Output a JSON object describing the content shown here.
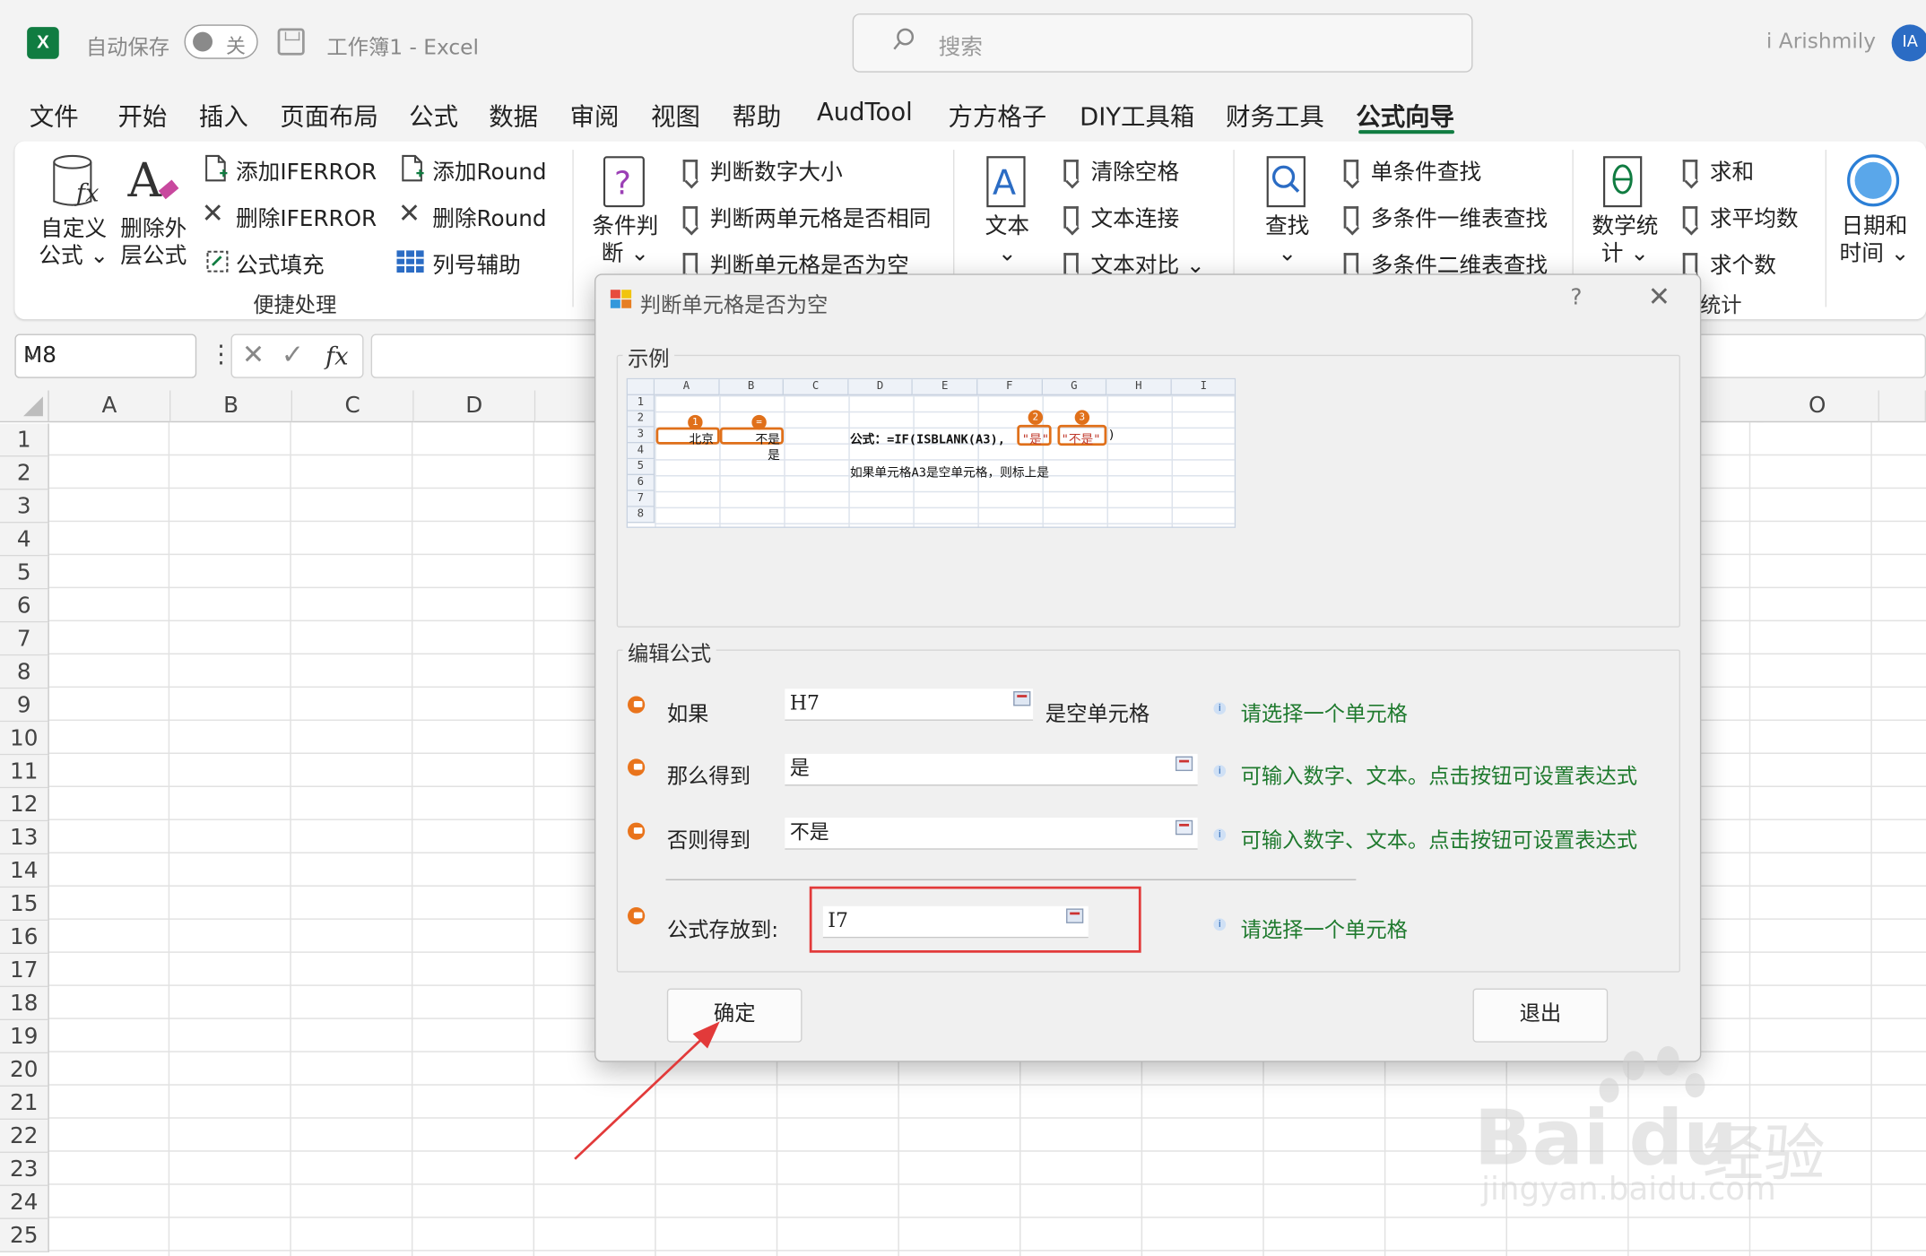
{
  "app": {
    "logo": "X",
    "autosave_label": "自动保存",
    "autosave_state": "关",
    "doc_title": "工作簿1  -  Excel",
    "search_placeholder": "搜索",
    "user_name": "i Arishmily",
    "user_initials": "IA"
  },
  "menu_tabs": [
    "文件",
    "开始",
    "插入",
    "页面布局",
    "公式",
    "数据",
    "审阅",
    "视图",
    "帮助",
    "AudTool",
    "方方格子",
    "DIY工具箱",
    "财务工具",
    "公式向导"
  ],
  "ribbon": {
    "custom_formula": "自定义\n公式 ⌄",
    "delete_outer": "删除外\n层公式",
    "add_iferror": "添加IFERROR",
    "del_iferror": "删除IFERROR",
    "formula_fill": "公式填充",
    "add_round": "添加Round",
    "del_round": "删除Round",
    "col_helper": "列号辅助",
    "group_quick": "便捷处理",
    "cond": "条件判\n断 ⌄",
    "is_number_size": "判断数字大小",
    "two_cells_same": "判断两单元格是否相同",
    "cell_is_empty": "判断单元格是否为空",
    "text": "文本\n⌄",
    "clear_spaces": "清除空格",
    "text_concat": "文本连接",
    "text_compare": "文本对比  ⌄",
    "lookup": "查找\n⌄",
    "single_lookup": "单条件查找",
    "multi_1d": "多条件一维表查找",
    "multi_2d": "多条件二维表查找",
    "math_stats": "数学统\n计 ⌄",
    "sum": "求和",
    "average": "求平均数",
    "count": "求个数",
    "stats_group": "统计",
    "datetime": "日期和\n时间 ⌄"
  },
  "formula_bar": {
    "name_box": "M8",
    "fx": "fx"
  },
  "sheet": {
    "columns": [
      "A",
      "B",
      "C",
      "D",
      "O"
    ],
    "rows": [
      "1",
      "2",
      "3",
      "4",
      "5",
      "6",
      "7",
      "8",
      "9",
      "10",
      "11",
      "12",
      "13",
      "14",
      "15",
      "16",
      "17",
      "18",
      "19",
      "20",
      "21",
      "22",
      "23",
      "24",
      "25"
    ]
  },
  "dialog": {
    "title": "判断单元格是否为空",
    "help": "?",
    "close": "✕",
    "example_legend": "示例",
    "example": {
      "cols": [
        "A",
        "B",
        "C",
        "D",
        "E",
        "F",
        "G",
        "H",
        "I"
      ],
      "rows": [
        "1",
        "2",
        "3",
        "4",
        "5",
        "6",
        "7",
        "8"
      ],
      "a3": "北京",
      "b3": "不是",
      "b4": "是",
      "formula": "公式：=IF(ISBLANK(A3),",
      "yes": "\"是\"",
      "no": "\"不是\"",
      "close_paren": ")",
      "desc": "如果单元格A3是空单元格，则标上是",
      "badge1": "1",
      "badge2": "2",
      "badge3": "3",
      "badge_eq": "="
    },
    "edit_legend": "编辑公式",
    "if_label": "如果",
    "if_value": "H7",
    "if_suffix": "是空单元格",
    "if_hint": "请选择一个单元格",
    "then_label": "那么得到",
    "then_value": "是",
    "then_hint": "可输入数字、文本。点击按钮可设置表达式",
    "else_label": "否则得到",
    "else_value": "不是",
    "else_hint": "可输入数字、文本。点击按钮可设置表达式",
    "store_label": "公式存放到:",
    "store_value": "I7",
    "store_hint": "请选择一个单元格",
    "ok": "确定",
    "exit": "退出"
  },
  "watermark": {
    "brand": "Bai",
    "brand2": "du",
    "suffix": "经验",
    "url": "jingyan.baidu.com"
  },
  "colors": {
    "excel_green": "#107c41",
    "highlight": "#e23a3a",
    "hint_green": "#1f7a2e",
    "accent_orange": "#e0701a"
  }
}
